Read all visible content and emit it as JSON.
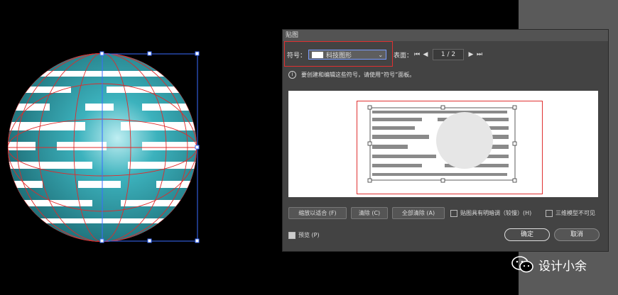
{
  "dialog": {
    "title": "贴图",
    "symbol_label": "符号：",
    "symbol_value": "科技图形",
    "surface_label": "表面：",
    "page_value": "1 / 2",
    "info_text": "要创建和编辑这些符号，请使用“符号”面板。",
    "buttons": {
      "scale_to_fit": "缩放以适合 (F)",
      "clear": "清除 (C)",
      "clear_all": "全部清除 (A)",
      "ok": "确定",
      "cancel": "取消"
    },
    "checkboxes": {
      "shade_artwork": "贴图具有明暗调（较慢）(H)",
      "invisible_geometry": "三维模型不可见",
      "preview": "预览 (P)"
    }
  },
  "watermark": "设计小余",
  "colors": {
    "sphere": "#2f9aa5",
    "mesh": "#e02a2a",
    "selection": "#3a6cff"
  }
}
